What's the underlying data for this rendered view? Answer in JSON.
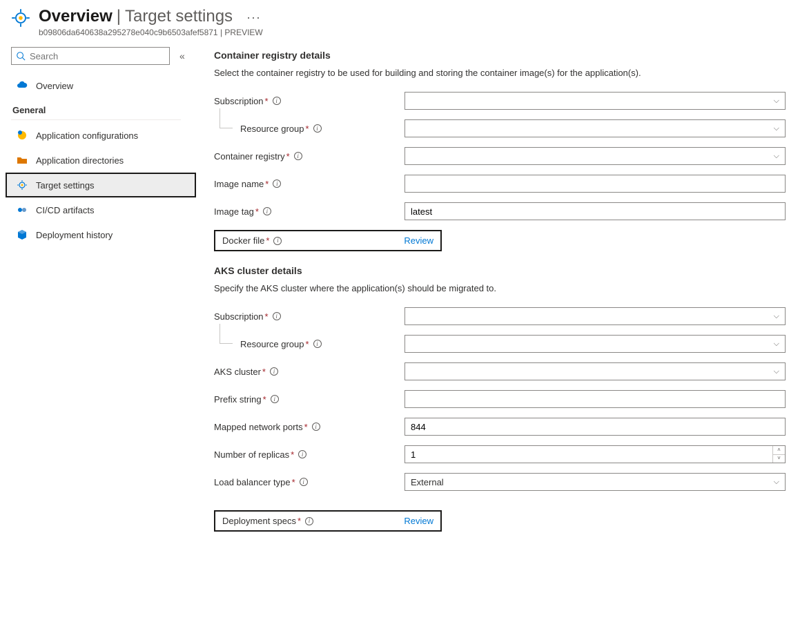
{
  "header": {
    "title": "Overview",
    "subtitle": "Target settings",
    "meta_id": "b09806da640638a295278e040c9b6503afef5871",
    "meta_suffix": "PREVIEW"
  },
  "sidebar": {
    "search_placeholder": "Search",
    "overview_label": "Overview",
    "group_general": "General",
    "items": {
      "app_config": "Application configurations",
      "app_dirs": "Application directories",
      "target_settings": "Target settings",
      "cicd": "CI/CD artifacts",
      "deploy_hist": "Deployment history"
    }
  },
  "registry": {
    "title": "Container registry details",
    "desc": "Select the container registry to be used for building and storing the container image(s) for the application(s).",
    "labels": {
      "subscription": "Subscription",
      "resource_group": "Resource group",
      "container_registry": "Container registry",
      "image_name": "Image name",
      "image_tag": "Image tag",
      "docker_file": "Docker file"
    },
    "values": {
      "image_tag": "latest"
    },
    "review_link": "Review"
  },
  "aks": {
    "title": "AKS cluster details",
    "desc": "Specify the AKS cluster where the application(s) should be migrated to.",
    "labels": {
      "subscription": "Subscription",
      "resource_group": "Resource group",
      "aks_cluster": "AKS cluster",
      "prefix_string": "Prefix string",
      "mapped_ports": "Mapped network ports",
      "replicas": "Number of replicas",
      "lb_type": "Load balancer type",
      "deployment_specs": "Deployment specs"
    },
    "values": {
      "mapped_ports": "844",
      "replicas": "1",
      "lb_type": "External"
    },
    "review_link": "Review"
  }
}
